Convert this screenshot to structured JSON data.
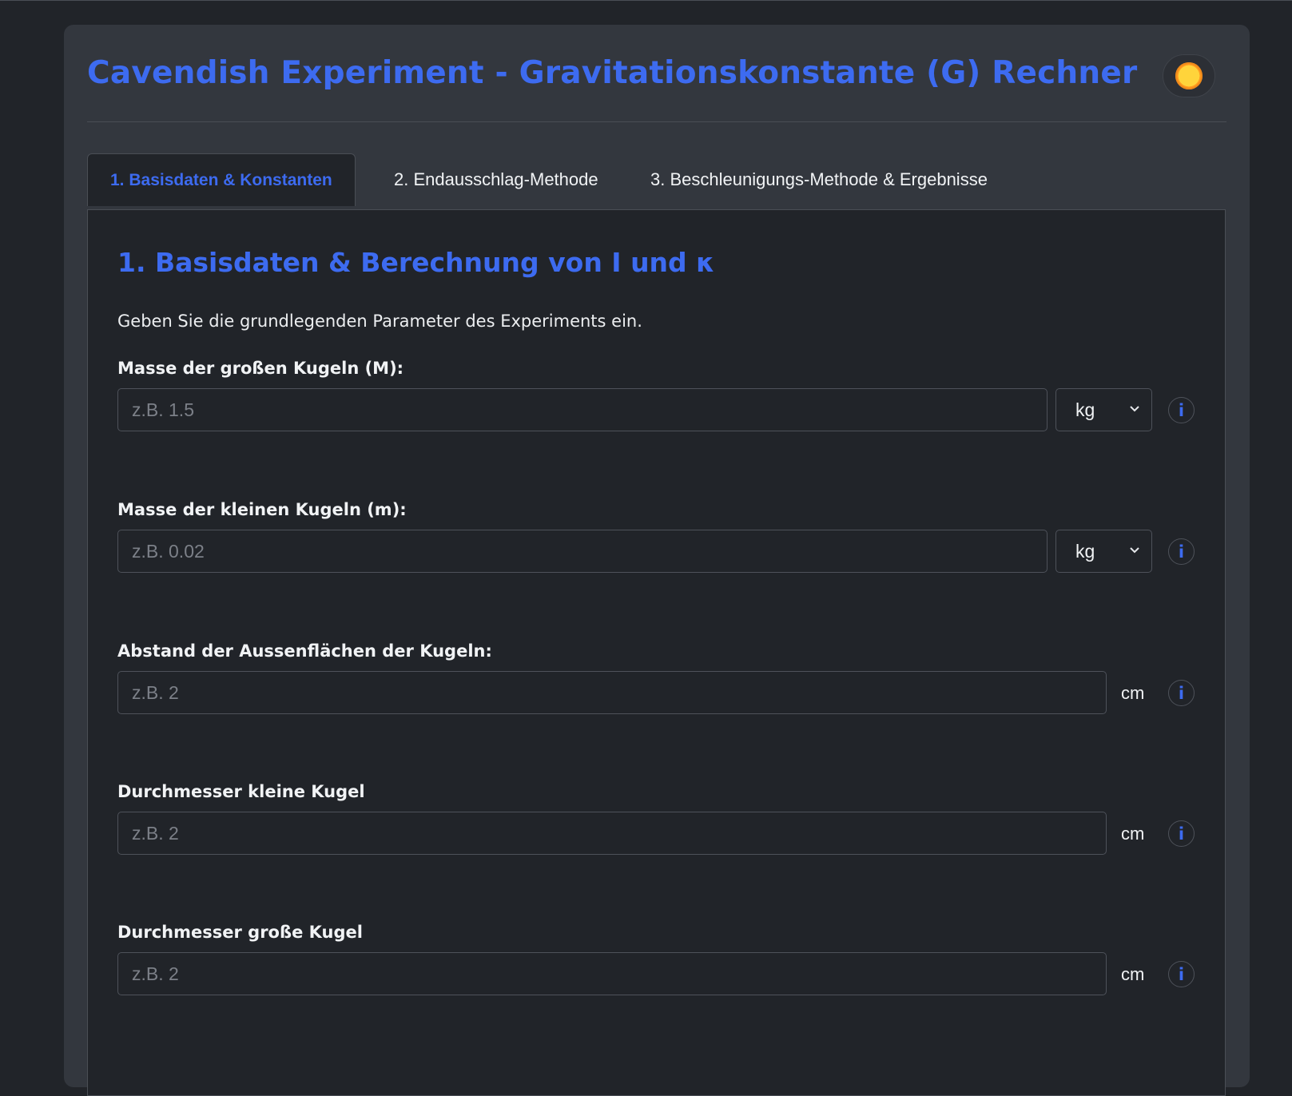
{
  "app": {
    "title": "Cavendish Experiment - Gravitationskonstante (G) Rechner",
    "theme_toggle_icon": "sun-icon"
  },
  "tabs": [
    {
      "label": "1. Basisdaten & Konstanten",
      "active": true
    },
    {
      "label": "2. Endausschlag-Methode",
      "active": false
    },
    {
      "label": "3. Beschleunigungs-Methode & Ergebnisse",
      "active": false
    }
  ],
  "section": {
    "title": "1. Basisdaten & Berechnung von I und κ",
    "intro": "Geben Sie die grundlegenden Parameter des Experiments ein."
  },
  "fields": [
    {
      "label": "Masse der großen Kugeln (M):",
      "placeholder": "z.B. 1.5",
      "value": "",
      "unit": "kg",
      "unit_type": "select",
      "info": "i"
    },
    {
      "label": "Masse der kleinen Kugeln (m):",
      "placeholder": "z.B. 0.02",
      "value": "",
      "unit": "kg",
      "unit_type": "select",
      "info": "i"
    },
    {
      "label": "Abstand der Aussenflächen der Kugeln:",
      "placeholder": "z.B. 2",
      "value": "",
      "unit": "cm",
      "unit_type": "static",
      "info": "i"
    },
    {
      "label": "Durchmesser kleine Kugel",
      "placeholder": "z.B. 2",
      "value": "",
      "unit": "cm",
      "unit_type": "static",
      "info": "i"
    },
    {
      "label": "Durchmesser große Kugel",
      "placeholder": "z.B. 2",
      "value": "",
      "unit": "cm",
      "unit_type": "static",
      "info": "i"
    }
  ],
  "colors": {
    "accent": "#3d6bf0",
    "page_bg": "#212429",
    "card_bg": "#33373e"
  }
}
